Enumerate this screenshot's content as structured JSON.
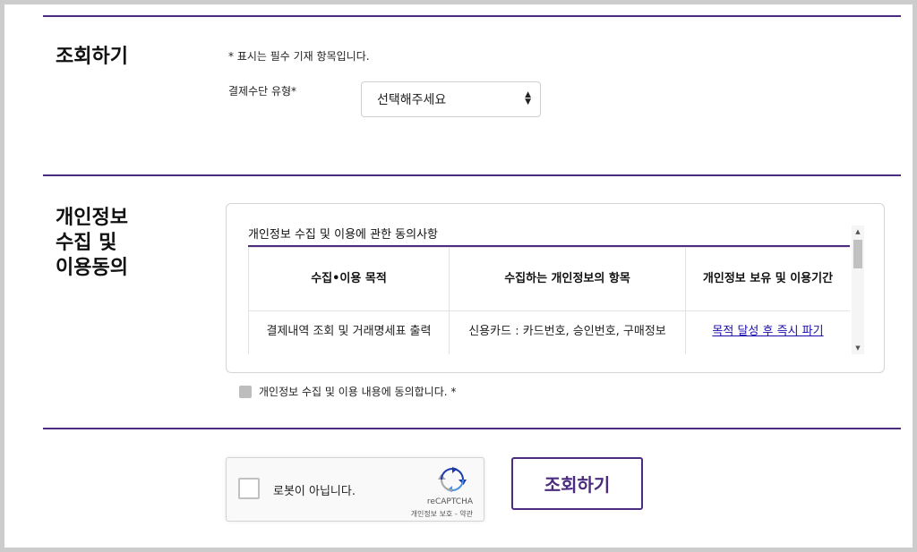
{
  "lookup_section": {
    "title": "조회하기",
    "required_note": "* 표시는 필수 기재 항목입니다.",
    "payment_type_label": "결제수단 유형*",
    "payment_type_value": "선택해주세요"
  },
  "privacy_section": {
    "title_line1": "개인정보",
    "title_line2": "수집 및",
    "title_line3": "이용동의",
    "consent_heading": "개인정보 수집 및 이용에 관한 동의사항",
    "table": {
      "headers": [
        "수집•이용 목적",
        "수집하는 개인정보의 항목",
        "개인정보 보유 및 이용기간"
      ],
      "rows": [
        [
          "결제내역 조회 및 거래명세표 출력",
          "신용카드 : 카드번호, 승인번호, 구매정보",
          "목적 달성 후 즉시 파기"
        ]
      ]
    },
    "agree_label": "개인정보 수집 및 이용 내용에 동의합니다. *"
  },
  "recaptcha": {
    "label": "로봇이 아닙니다.",
    "brand": "reCAPTCHA",
    "links": "개인정보 보호 - 약관"
  },
  "submit_button": "조회하기",
  "colors": {
    "accent": "#4b2c7f",
    "link": "#1a0dab",
    "border": "#d4d4d4"
  }
}
